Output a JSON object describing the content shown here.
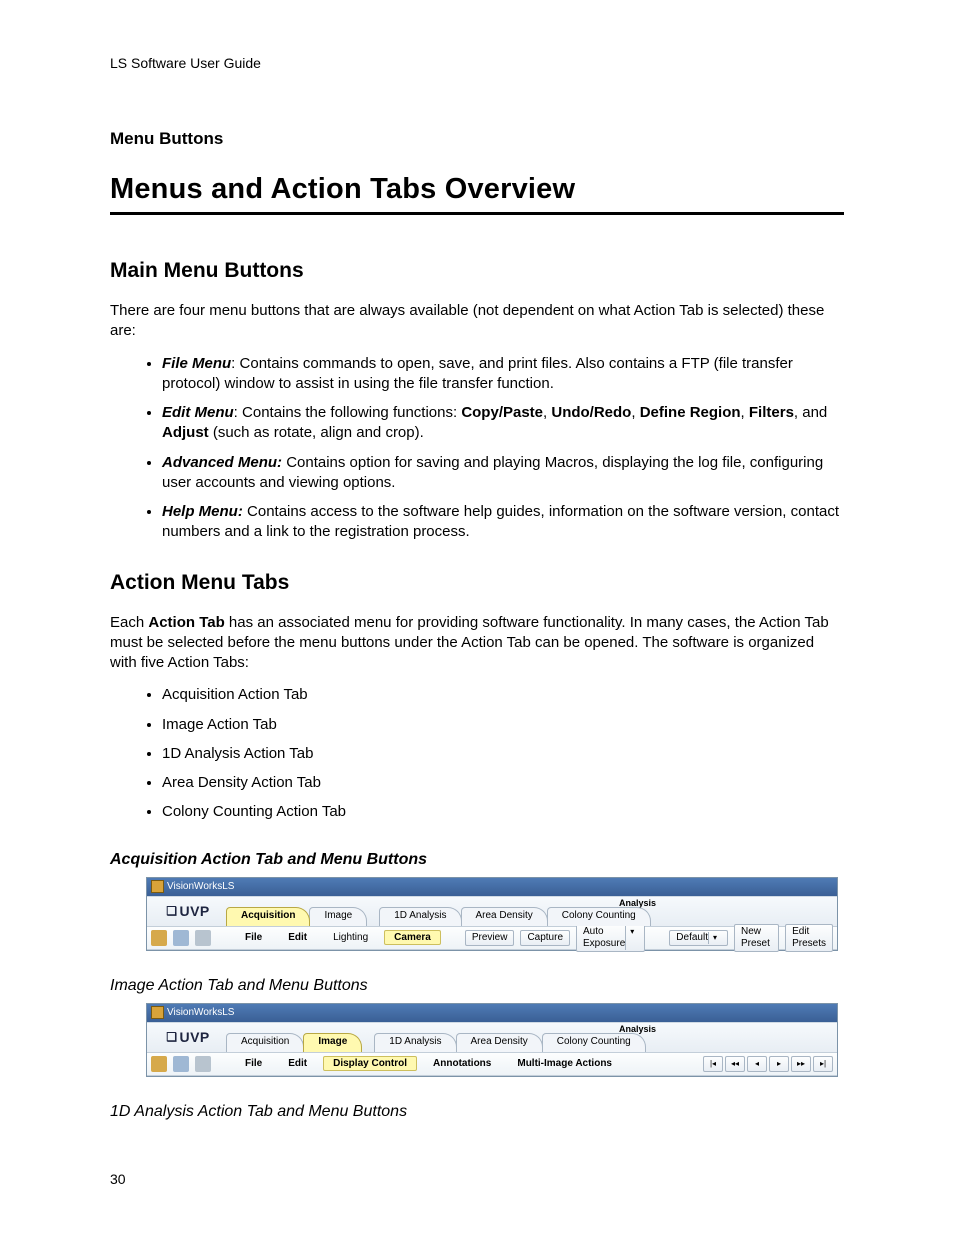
{
  "header": "LS Software User Guide",
  "section_label": "Menu Buttons",
  "chapter_title": "Menus and Action Tabs Overview",
  "page_number": "30",
  "main_menu": {
    "heading": "Main Menu Buttons",
    "intro": "There are four menu buttons that are always available (not dependent on what Action Tab is selected) these are:",
    "items": [
      {
        "name": "File Menu",
        "sep": ": ",
        "text": "Contains commands to open, save, and print files.  Also contains a FTP (file transfer protocol) window to assist in using the file transfer function."
      },
      {
        "name": "Edit Menu",
        "sep": ": ",
        "pre": "Contains the following functions: ",
        "bolds": [
          "Copy/Paste",
          "Undo/Redo",
          "Define Region",
          "Filters"
        ],
        "and_bold": "Adjust",
        "tail": " (such as rotate, align and crop)."
      },
      {
        "name": "Advanced Menu:",
        "sep": " ",
        "text": "Contains option for saving and playing Macros, displaying the log file, configuring user accounts and viewing options."
      },
      {
        "name": "Help Menu:",
        "sep": " ",
        "text": "Contains access to the software help guides, information on the software version, contact numbers and a link to the registration process."
      }
    ]
  },
  "action_tabs": {
    "heading": "Action Menu Tabs",
    "intro_pre": "Each ",
    "intro_bold": "Action Tab",
    "intro_post": " has an associated menu for providing software functionality. In many cases, the Action Tab must be selected before the menu buttons under the Action Tab can be opened. The software is organized with five Action Tabs:",
    "items": [
      "Acquisition Action Tab",
      "Image Action Tab",
      "1D Analysis Action Tab",
      "Area Density Action Tab",
      "Colony Counting Action Tab"
    ]
  },
  "subsections": {
    "acq_heading": "Acquisition Action Tab and Menu Buttons",
    "img_heading": "Image Action Tab and Menu Buttons",
    "oned_heading": "1D Analysis Action Tab and Menu Buttons"
  },
  "app": {
    "window_title": "VisionWorksLS",
    "logo": "UVP",
    "analysis_label": "Analysis",
    "top_tabs": [
      "Acquisition",
      "Image",
      "1D Analysis",
      "Area Density",
      "Colony Counting"
    ],
    "acq": {
      "active_tab": "Acquisition",
      "menus": [
        "File",
        "Edit",
        "Lighting",
        "Camera"
      ],
      "active_menu": "Camera",
      "buttons": [
        "Preview",
        "Capture",
        "Auto Exposure"
      ],
      "preset_default": "Default",
      "preset_new": "New Preset",
      "preset_edit": "Edit Presets"
    },
    "img": {
      "active_tab": "Image",
      "menus": [
        "File",
        "Edit",
        "Display Control",
        "Annotations",
        "Multi-Image Actions"
      ],
      "active_menu": "Display Control",
      "nav": [
        "|◂",
        "◂◂",
        "◂",
        "▸",
        "▸▸",
        "▸|"
      ]
    }
  }
}
